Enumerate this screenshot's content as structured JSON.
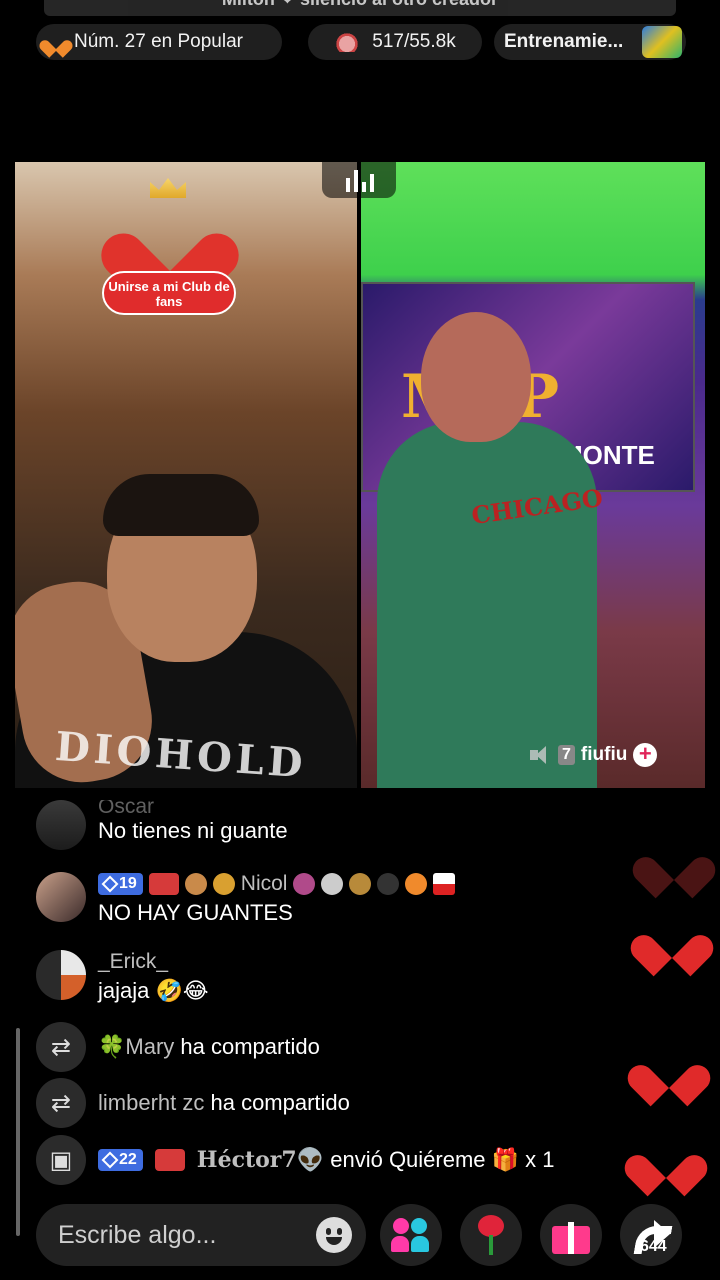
{
  "top_banner": {
    "text": "Milton ❤ silencio al otro creador"
  },
  "stats": {
    "rank_label": "Núm. 27 en Popular",
    "likes_label": "517/55.8k",
    "training_label": "Entrenamie..."
  },
  "stream": {
    "fan_club_label": "Unirse a mi Club de fans",
    "left_shirt_text": "DIOHOLD",
    "right_banner_text": "MVP",
    "right_banner_sub": "MONTE",
    "right_shirt_text": "CHICAGO",
    "guest_number": "7",
    "guest_name": "fiufiu"
  },
  "comments": [
    {
      "name": "Oscar",
      "text": "No tienes ni guante"
    },
    {
      "name": "Nicol",
      "level": "19",
      "text": "NO HAY GUANTES"
    },
    {
      "name": "_Erick_",
      "text": "jajaja 🤣😂"
    }
  ],
  "system_messages": [
    {
      "icon": "share-icon",
      "name": "🍀Mary",
      "action": "ha compartido"
    },
    {
      "icon": "share-icon",
      "name": "limberht zc",
      "action": "ha compartido"
    },
    {
      "icon": "gift-icon",
      "level": "22",
      "name": "Héctor7👽",
      "action": "envió Quiéreme 🎁 x 1"
    }
  ],
  "bottom_bar": {
    "input_placeholder": "Escribe algo...",
    "share_count": "644"
  }
}
